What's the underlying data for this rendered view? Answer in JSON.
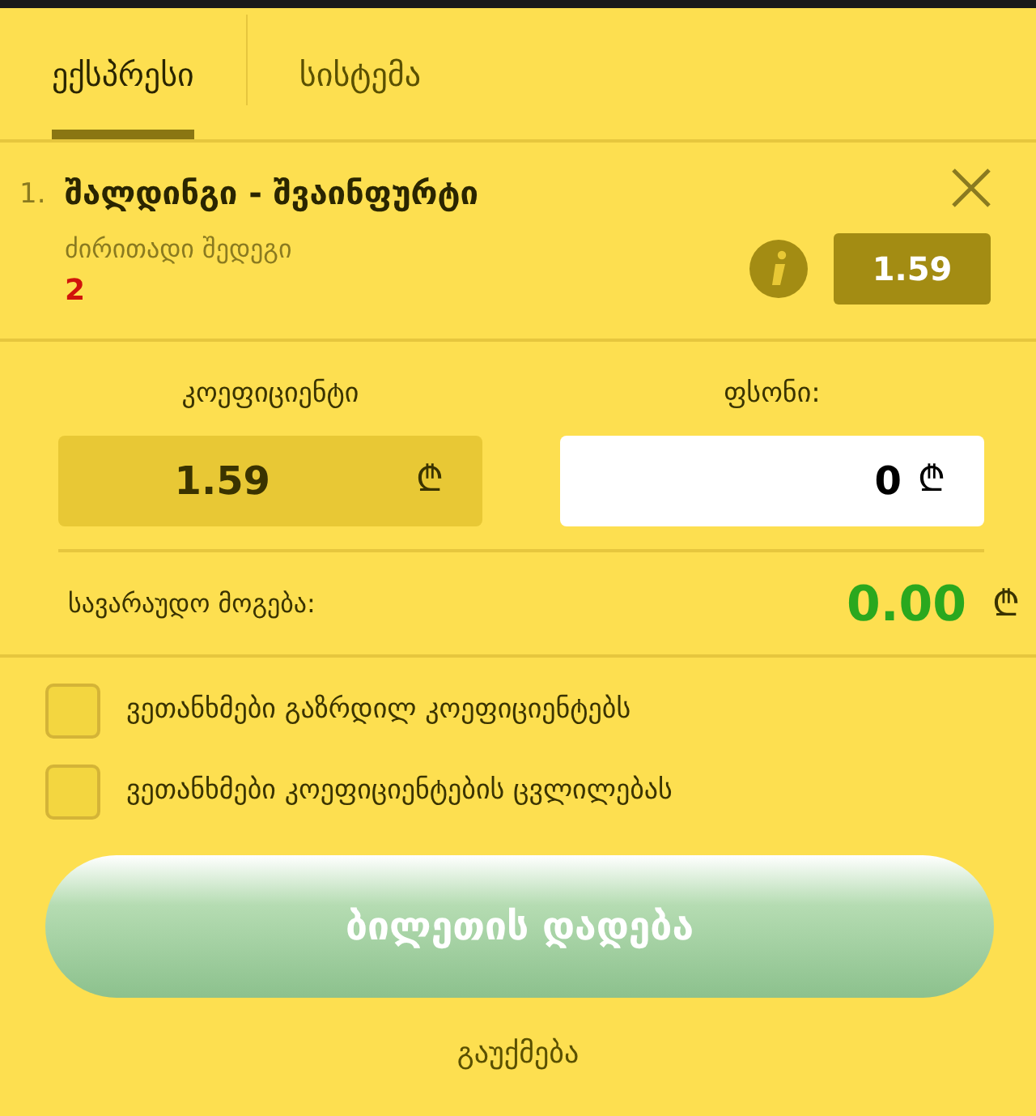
{
  "tabs": [
    {
      "label": "ექსპრესი",
      "selected": true
    },
    {
      "label": "სისტემა",
      "selected": false
    }
  ],
  "bets": [
    {
      "number": "1.",
      "match": "შალდინგი - შვაინფურტი",
      "market": "ძირითადი შედეგი",
      "pick": "2",
      "odds": "1.59"
    }
  ],
  "odds_field": {
    "label": "კოეფიციენტი",
    "value": "1.59",
    "currency": "₾"
  },
  "stake_field": {
    "label": "ფსონი:",
    "value": "0",
    "currency": "₾"
  },
  "potential_win": {
    "label": "სავარაუდო მოგება:",
    "value": "0.00",
    "currency": "₾"
  },
  "options": [
    {
      "label": "ვეთანხმები გაზრდილ კოეფიციენტებს",
      "checked": false
    },
    {
      "label": "ვეთანხმები კოეფიციენტების ცვლილებას",
      "checked": false
    }
  ],
  "place_button": {
    "label": "ბილეთის დადება",
    "disabled": true
  },
  "cancel": "გაუქმება"
}
